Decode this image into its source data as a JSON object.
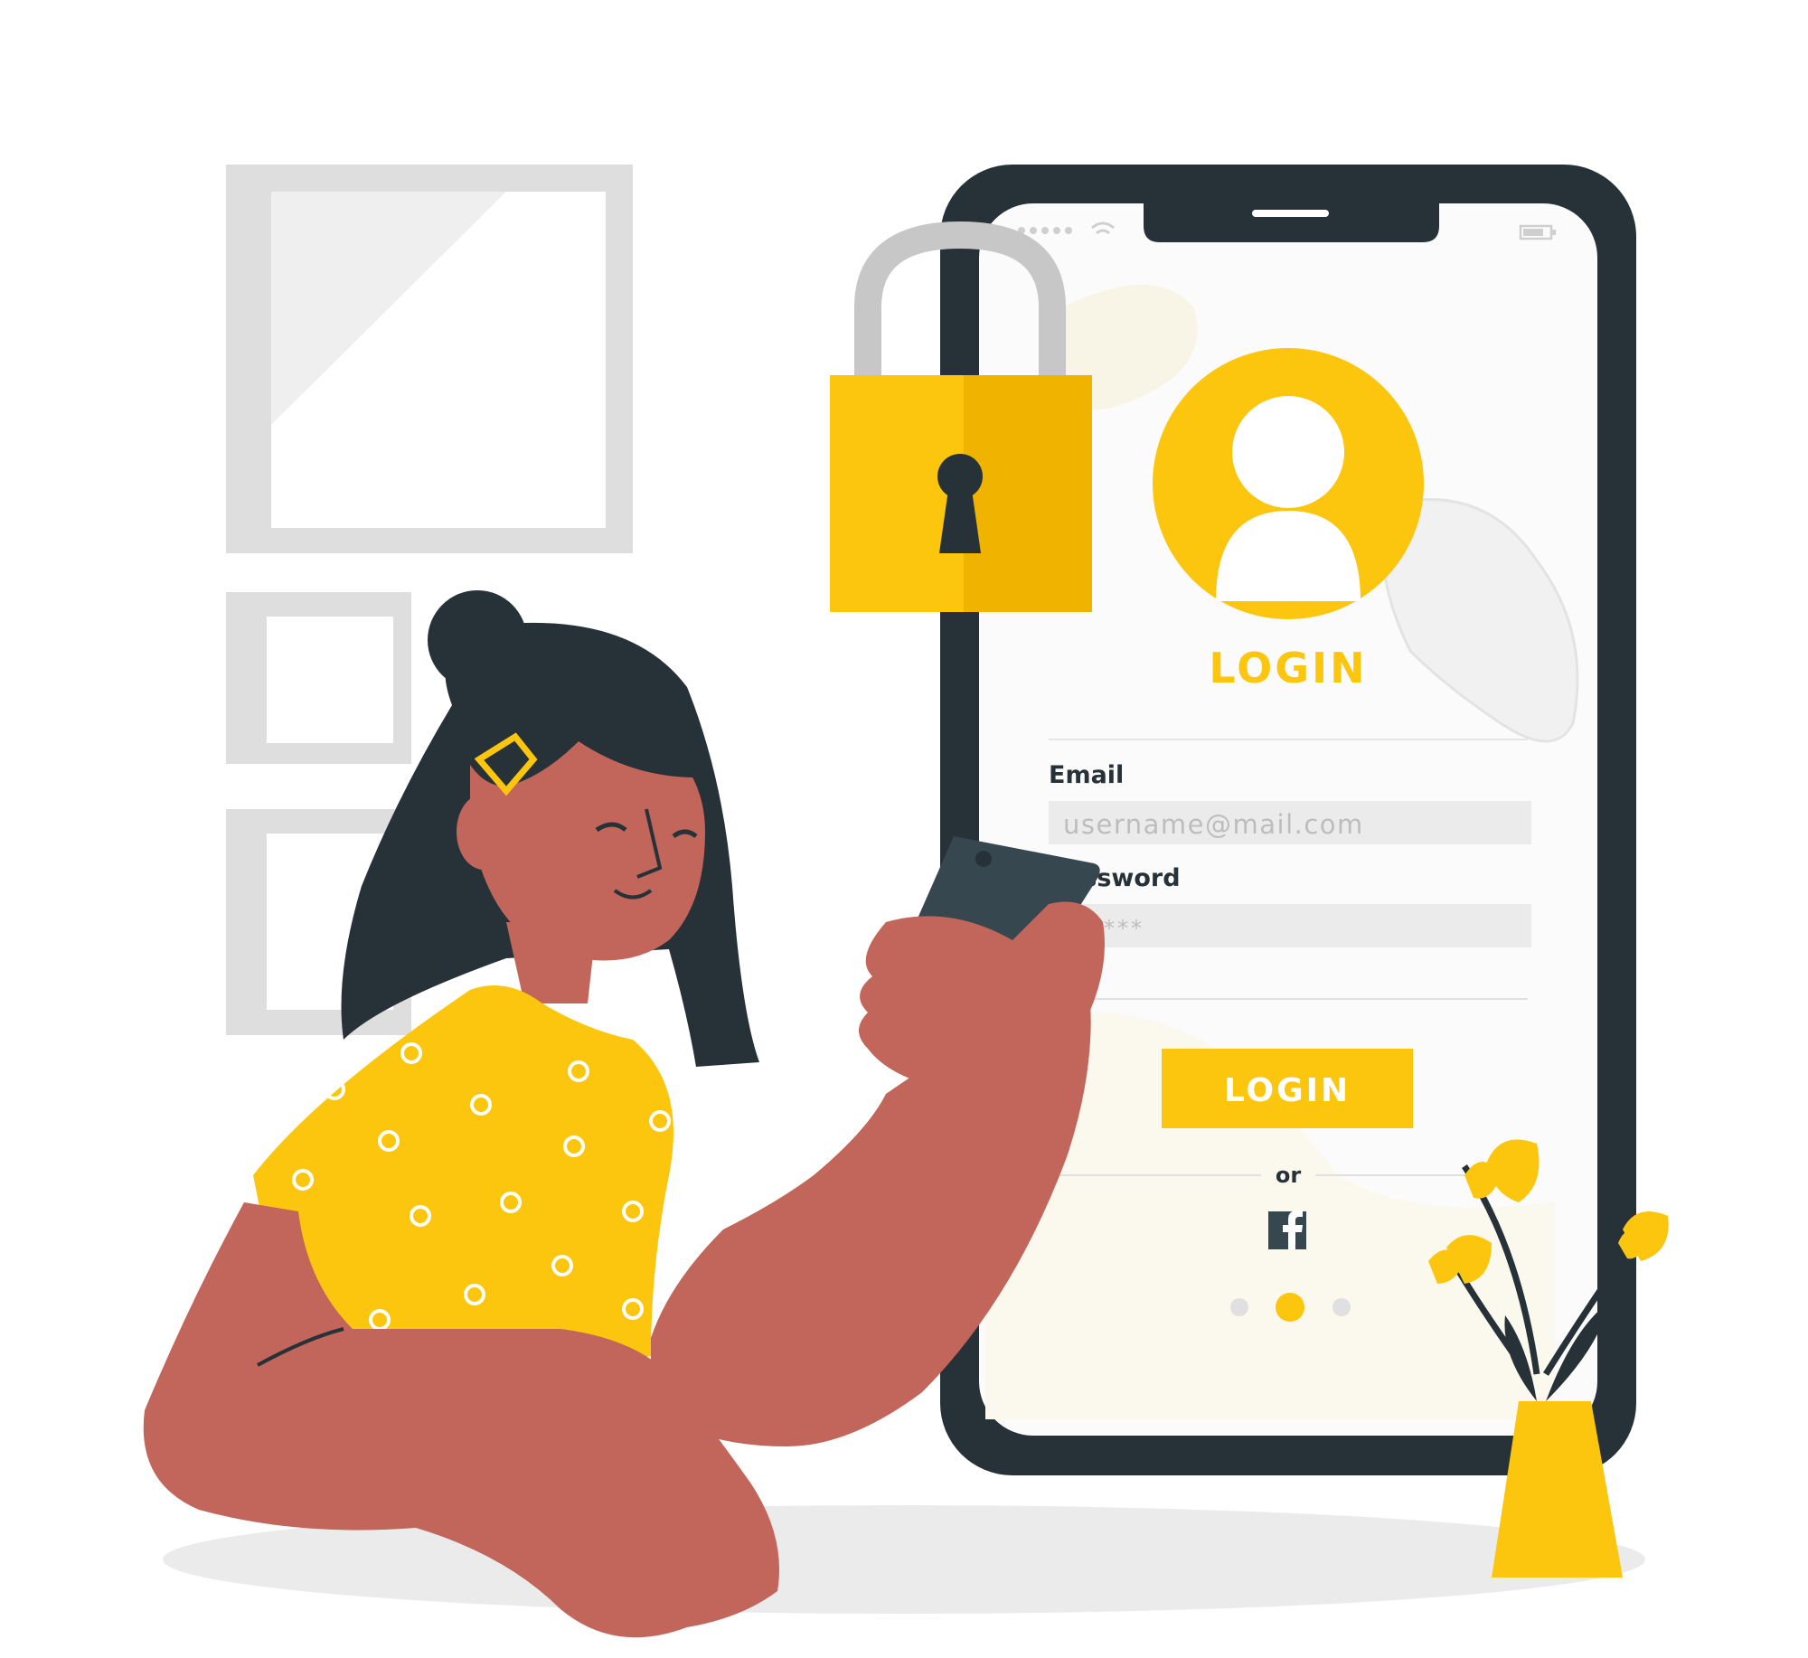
{
  "phone": {
    "title": "LOGIN",
    "email_label": "Email",
    "email_placeholder": "username@mail.com",
    "password_label": "Password",
    "password_placeholder": "******",
    "login_button": "LOGIN",
    "divider_text": "or",
    "social_icon": "facebook-icon",
    "carousel": {
      "count": 3,
      "active_index": 1
    }
  },
  "colors": {
    "accent": "#FCC60E",
    "accent_dark": "#F0B400",
    "dark": "#263238",
    "skin": "#C2655A",
    "gray": "#E0E0E0"
  },
  "icons": [
    "padlock-icon",
    "user-avatar-icon",
    "signal-icon",
    "wifi-icon",
    "battery-icon",
    "facebook-icon"
  ]
}
